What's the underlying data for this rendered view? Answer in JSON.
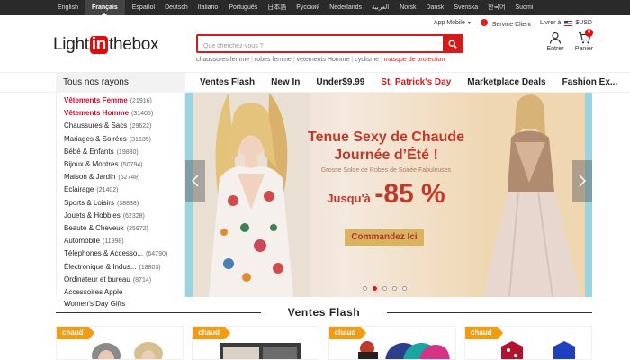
{
  "languages": [
    {
      "label": "English",
      "active": false
    },
    {
      "label": "Français",
      "active": true
    },
    {
      "label": "Español",
      "active": false
    },
    {
      "label": "Deutsch",
      "active": false
    },
    {
      "label": "Italiano",
      "active": false
    },
    {
      "label": "Português",
      "active": false
    },
    {
      "label": "日本語",
      "active": false
    },
    {
      "label": "Русский",
      "active": false
    },
    {
      "label": "Nederlands",
      "active": false
    },
    {
      "label": "العربية",
      "active": false
    },
    {
      "label": "Norsk",
      "active": false
    },
    {
      "label": "Dansk",
      "active": false
    },
    {
      "label": "Svenska",
      "active": false
    },
    {
      "label": "한국어",
      "active": false
    },
    {
      "label": "Suomi",
      "active": false
    }
  ],
  "utility": {
    "app_mobile": "App Mobile",
    "service": "Service Client",
    "deliver_to": "Livrer à",
    "currency": "$USD"
  },
  "logo": {
    "pre": "Light",
    "mid": "in",
    "post": "thebox"
  },
  "search": {
    "placeholder": "Que cherchez-vous ?"
  },
  "hotwords": [
    "chaussures femme",
    "robes femme",
    "vetements Homme",
    "cyclisme"
  ],
  "hotword_promo": "masque de protection",
  "account": {
    "label": "Entrer"
  },
  "cart": {
    "label": "Panier",
    "count": "0"
  },
  "nav": {
    "all_categories": "Tous nos rayons",
    "links": [
      "Ventes Flash",
      "New In",
      "Under$9.99",
      "St. Patrick's Day",
      "Marketplace Deals",
      "Fashion Ex..."
    ]
  },
  "categories": [
    {
      "label": "Vêtements Femme",
      "count": "(21916)",
      "highlight": true
    },
    {
      "label": "Vêtements Homme",
      "count": "(31405)",
      "highlight": true
    },
    {
      "label": "Chaussures & Sacs",
      "count": "(29622)",
      "highlight": false
    },
    {
      "label": "Mariages & Soirées",
      "count": "(31635)",
      "highlight": false
    },
    {
      "label": "Bébé & Enfants",
      "count": "(19830)",
      "highlight": false
    },
    {
      "label": "Bijoux & Montres",
      "count": "(50794)",
      "highlight": false
    },
    {
      "label": "Maison & Jardin",
      "count": "(62748)",
      "highlight": false
    },
    {
      "label": "Eclairage",
      "count": "(21402)",
      "highlight": false
    },
    {
      "label": "Sports & Loisirs",
      "count": "(38838)",
      "highlight": false
    },
    {
      "label": "Jouets & Hobbies",
      "count": "(62328)",
      "highlight": false
    },
    {
      "label": "Beauté & Cheveux",
      "count": "(35972)",
      "highlight": false
    },
    {
      "label": "Automobile",
      "count": "(11998)",
      "highlight": false
    },
    {
      "label": "Téléphones & Accesso...",
      "count": "(64790)",
      "highlight": false
    },
    {
      "label": "Électronique & Indus...",
      "count": "(18803)",
      "highlight": false
    },
    {
      "label": "Ordinateur et bureau",
      "count": "(8714)",
      "highlight": false
    },
    {
      "label": "Accessoires Apple",
      "count": "",
      "highlight": false
    },
    {
      "label": "Women's Day Gifts",
      "count": "",
      "highlight": false
    }
  ],
  "banner": {
    "line1": "Tenue Sexy de Chaude",
    "line2": "Journée d’Été !",
    "subtitle": "Grosse Solde de Robes de Soirée Fabuleuses",
    "discount_prefix": "Jusqu'à",
    "discount_value": "-85 %",
    "cta": "Commandez Ici",
    "active_slide": 2,
    "slide_count": 5
  },
  "flash": {
    "title": "Ventes Flash",
    "tags": [
      "chaud",
      "chaud",
      "chaud",
      "chaud"
    ]
  },
  "colors": {
    "brand_red": "#d31b1b",
    "tag_orange": "#f39c12",
    "promo_red": "#c0392b",
    "cta_gold": "#d9b35e"
  }
}
